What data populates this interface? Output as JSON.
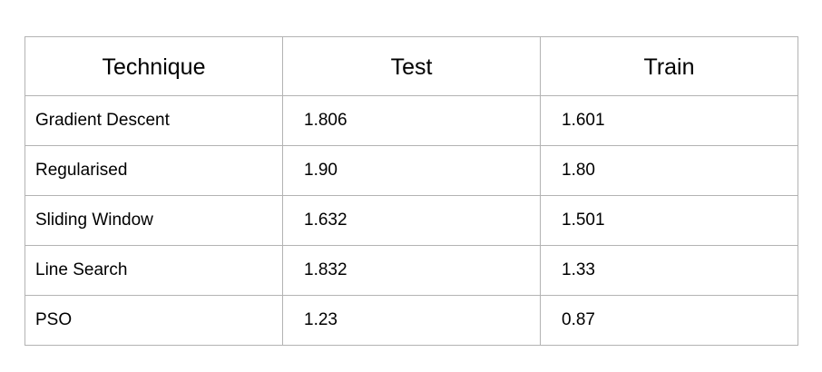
{
  "table": {
    "headers": [
      "Technique",
      "Test",
      "Train"
    ],
    "rows": [
      {
        "technique": "Gradient Descent",
        "test": "1.806",
        "train": "1.601"
      },
      {
        "technique": "Regularised",
        "test": "1.90",
        "train": "1.80"
      },
      {
        "technique": "Sliding Window",
        "test": "1.632",
        "train": "1.501"
      },
      {
        "technique": "Line Search",
        "test": "1.832",
        "train": "1.33"
      },
      {
        "technique": "PSO",
        "test": "1.23",
        "train": "0.87"
      }
    ]
  }
}
